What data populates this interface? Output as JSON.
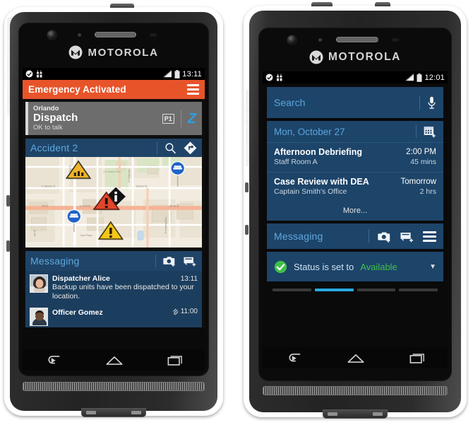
{
  "brand": "MOTOROLA",
  "accent": {
    "emergency_orange": "#e8542a",
    "panel_blue": "#1d4469",
    "title_blue": "#5aa6dc",
    "available_green": "#3fc04a",
    "page_active": "#29a8e0",
    "ptt_blue": "#2e9fe0"
  },
  "left_phone": {
    "status_bar": {
      "time": "13:11",
      "icons": [
        "check-circle-icon",
        "radio-icon",
        "signal-icon",
        "battery-icon"
      ]
    },
    "emergency": {
      "label": "Emergency Activated",
      "menu_icon": "hamburger-menu-icon"
    },
    "dispatch_card": {
      "org": "Orlando",
      "name": "Dispatch",
      "sub": "OK to talk",
      "priority_badge": "P1",
      "ptt_icon": "zello-ptt-icon",
      "ptt_glyph": "Z"
    },
    "incident": {
      "title": "Accident 2",
      "search_icon": "search-icon",
      "navigate_icon": "navigation-directions-icon",
      "map_markers": [
        {
          "type": "roadwork-warning-marker",
          "label": "roadwork",
          "color": "#f0b429"
        },
        {
          "type": "no-entry-marker",
          "label": "restricted",
          "color": "#1f63c8"
        },
        {
          "type": "incident-info-marker",
          "label": "incident info",
          "color": "#111111"
        },
        {
          "type": "accident-alert-marker",
          "label": "accident",
          "color": "#e2472b"
        },
        {
          "type": "no-entry-marker-2",
          "label": "restricted",
          "color": "#1f63c8"
        },
        {
          "type": "hazard-warning-marker",
          "label": "hazard",
          "color": "#f5c518"
        }
      ],
      "map_street_labels": [
        "E Jackson St",
        "Jackson St",
        "E Scott St",
        "SR 60",
        "SR 60 W",
        "N Morgan St",
        "E Kennedy Blvd",
        "N Florida Ave"
      ]
    },
    "messaging": {
      "title": "Messaging",
      "camera_icon": "camera-add-icon",
      "compose_icon": "message-add-icon",
      "items": [
        {
          "sender": "Dispatcher Alice",
          "time": "13:11",
          "text": "Backup units have been dispatched to your location.",
          "attachment": false
        },
        {
          "sender": "Officer Gomez",
          "time": "11:00",
          "text": "",
          "attachment": true
        }
      ]
    },
    "nav": {
      "back": "back-icon",
      "home": "home-icon",
      "recents": "recents-icon"
    }
  },
  "right_phone": {
    "status_bar": {
      "time": "12:01",
      "icons": [
        "check-circle-icon",
        "radio-icon",
        "signal-icon",
        "battery-icon"
      ]
    },
    "search": {
      "placeholder": "Search",
      "mic_icon": "microphone-icon"
    },
    "calendar": {
      "date": "Mon, October 27",
      "add_icon": "calendar-add-icon",
      "events": [
        {
          "title": "Afternoon Debriefing",
          "location": "Staff Room A",
          "time": "2:00 PM",
          "duration": "45 mins"
        },
        {
          "title": "Case Review with DEA",
          "location": "Captain Smith's Office",
          "time": "Tomorrow",
          "duration": "2 hrs"
        }
      ],
      "more_label": "More..."
    },
    "messaging": {
      "title": "Messaging",
      "camera_icon": "camera-add-icon",
      "compose_icon": "message-add-icon",
      "menu_icon": "hamburger-menu-icon"
    },
    "status": {
      "check_icon": "status-check-icon",
      "prefix": "Status is set to",
      "value": "Available",
      "caret_icon": "chevron-down-icon"
    },
    "pager": {
      "count": 4,
      "active_index": 1
    },
    "nav": {
      "back": "back-icon",
      "home": "home-icon",
      "recents": "recents-icon"
    }
  }
}
